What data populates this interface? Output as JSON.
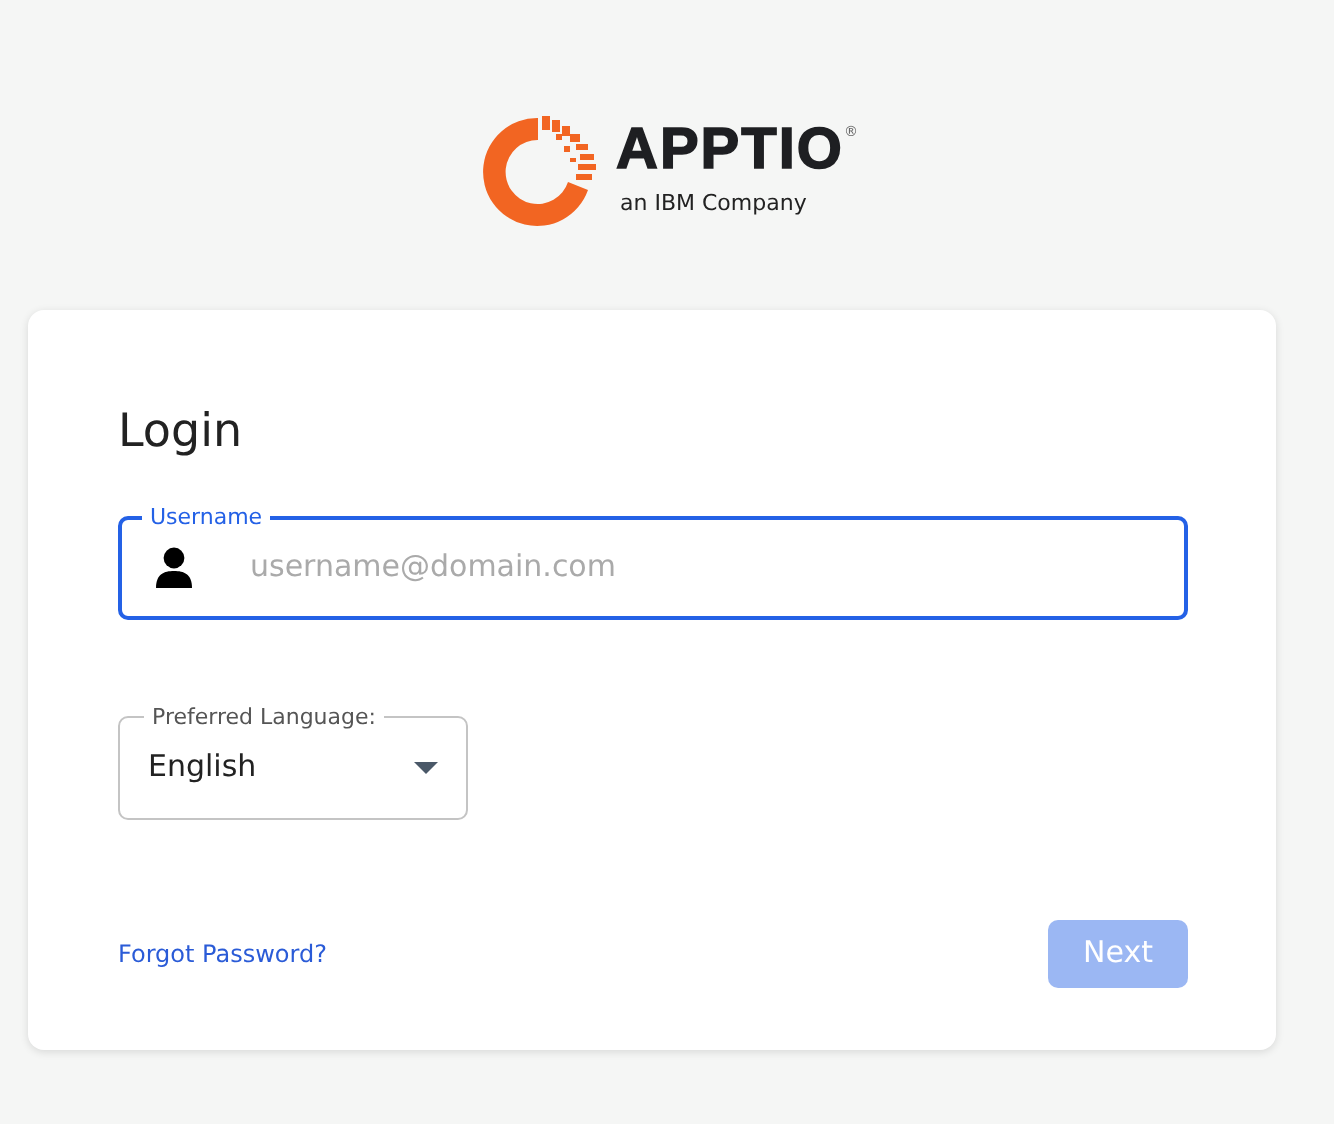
{
  "logo": {
    "wordmark": "APPTIO",
    "registered": "®",
    "tagline": "an IBM Company"
  },
  "card": {
    "title": "Login",
    "username": {
      "label": "Username",
      "placeholder": "username@domain.com",
      "focused": true
    },
    "language": {
      "label": "Preferred Language:",
      "value": "English"
    },
    "forgot_link": "Forgot Password?",
    "next_button": {
      "label": "Next",
      "disabled": true
    }
  }
}
